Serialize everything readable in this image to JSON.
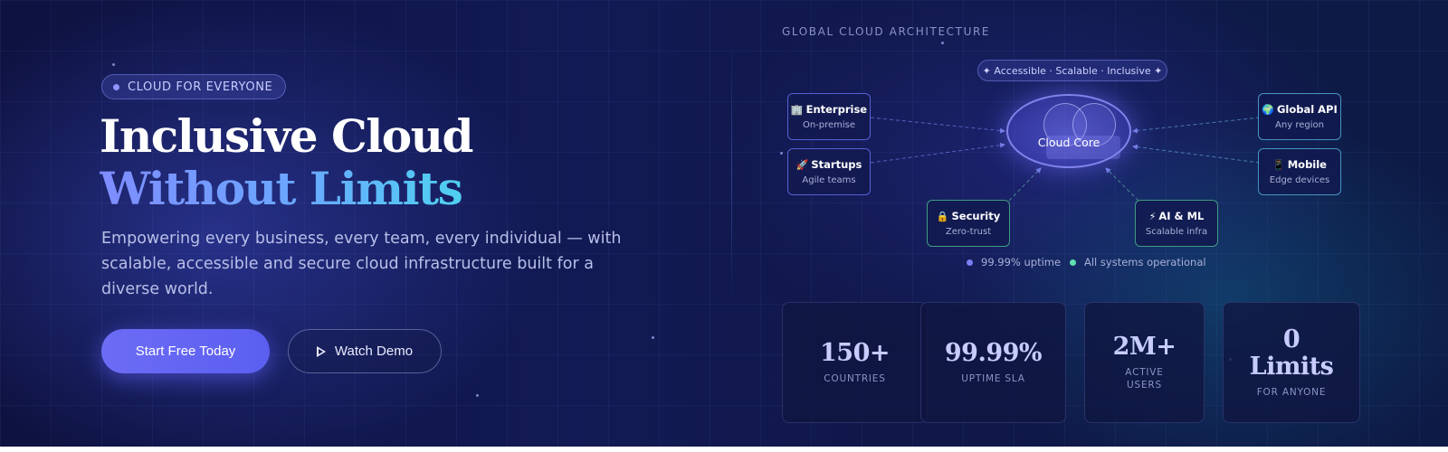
{
  "hero": {
    "badge": "CLOUD FOR EVERYONE",
    "title_line1": "Inclusive Cloud",
    "title_line2": "Without Limits",
    "subtitle": "Empowering every business, every team, every individual — with scalable, accessible and secure cloud infrastructure built for a diverse world.",
    "primary_cta": "Start Free Today",
    "secondary_cta": "Watch Demo"
  },
  "architecture": {
    "label": "GLOBAL CLOUD ARCHITECTURE",
    "tagline": "✦ Accessible · Scalable · Inclusive ✦",
    "core": "Cloud Core",
    "nodes": {
      "enterprise": {
        "icon": "🏢",
        "title": "Enterprise",
        "sub": "On-premise"
      },
      "startups": {
        "icon": "🚀",
        "title": "Startups",
        "sub": "Agile teams"
      },
      "security": {
        "icon": "🔒",
        "title": "Security",
        "sub": "Zero-trust"
      },
      "ai": {
        "icon": "⚡",
        "title": "AI & ML",
        "sub": "Scalable infra"
      },
      "api": {
        "icon": "🌍",
        "title": "Global API",
        "sub": "Any region"
      },
      "mobile": {
        "icon": "📱",
        "title": "Mobile",
        "sub": "Edge devices"
      }
    },
    "status": [
      {
        "text": "99.99% uptime",
        "color": "#7b7ff5"
      },
      {
        "text": "All systems operational",
        "color": "#5fe0b0"
      }
    ]
  },
  "stats": [
    {
      "value": "150+",
      "label": "COUNTRIES"
    },
    {
      "value": "99.99%",
      "label": "UPTIME SLA"
    },
    {
      "value": "2M+",
      "label": "ACTIVE USERS"
    },
    {
      "value": "0 Limits",
      "label": "FOR ANYONE"
    }
  ],
  "colors": {
    "accent": "#6c6cf5",
    "gradient_start": "#7f8cff",
    "gradient_end": "#4fd0f0",
    "background": "#121a55"
  }
}
